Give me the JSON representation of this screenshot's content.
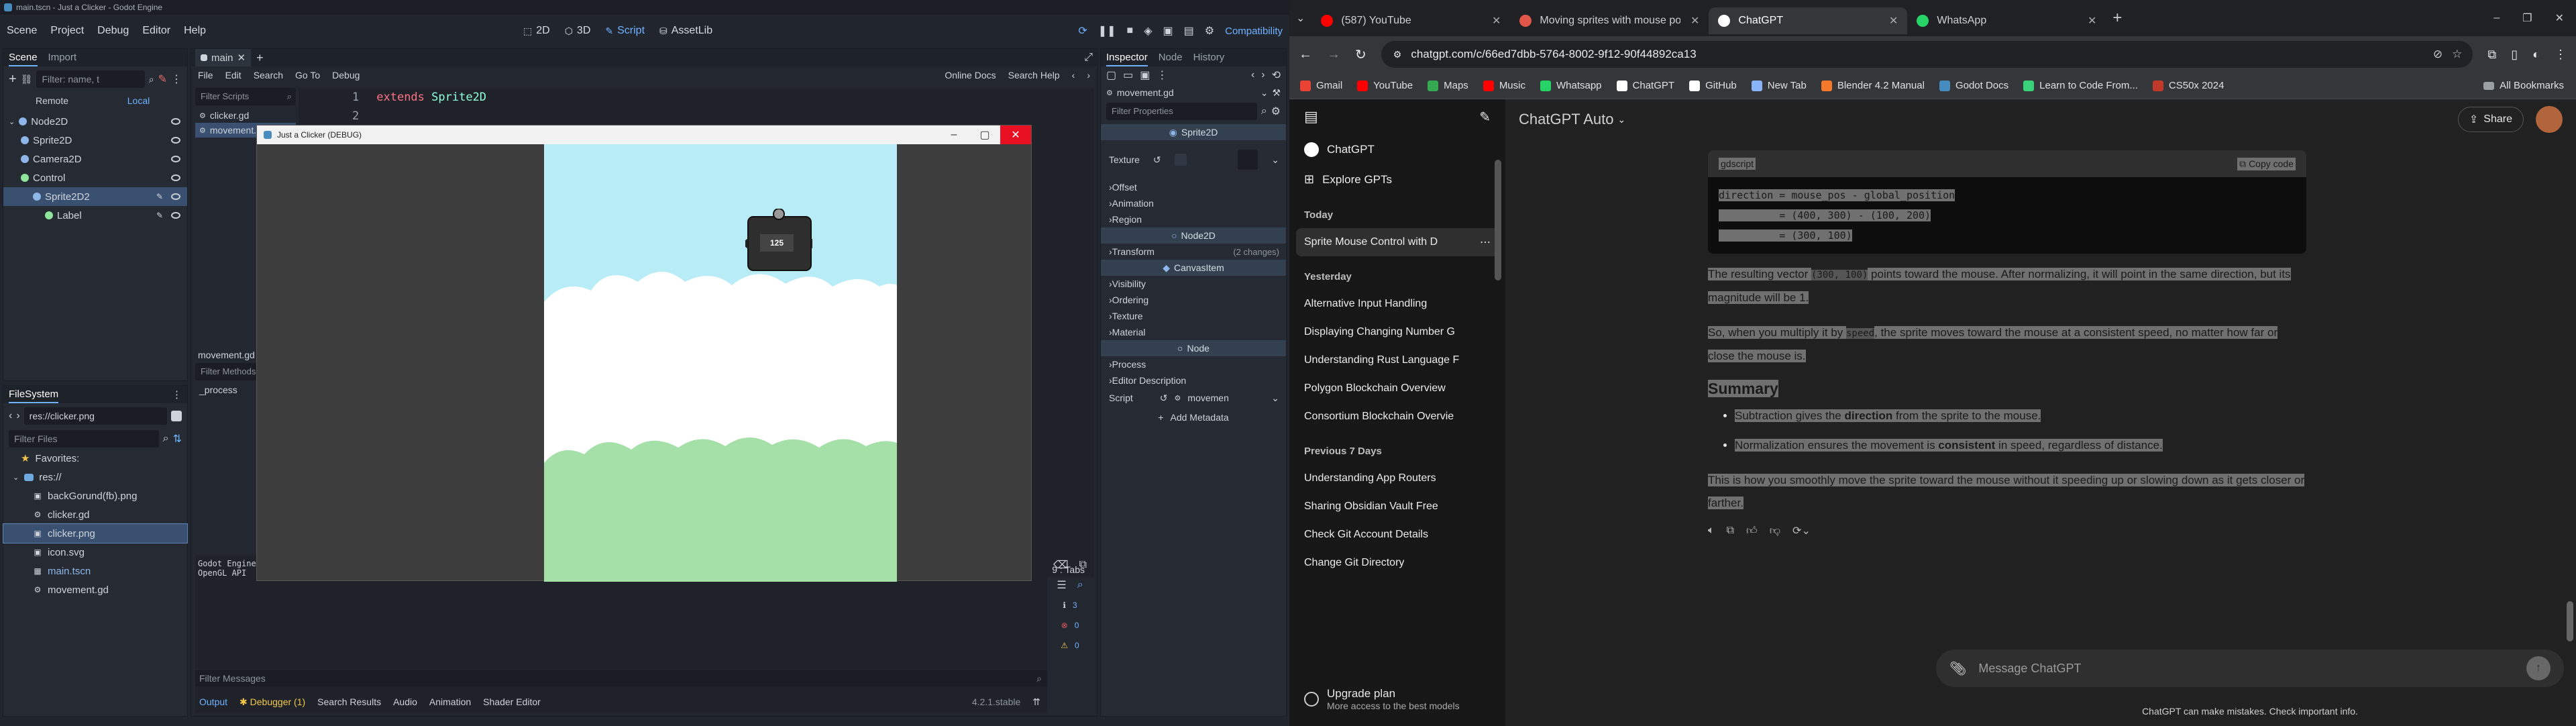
{
  "godot": {
    "window_title": "main.tscn - Just a Clicker - Godot Engine",
    "menu": [
      "Scene",
      "Project",
      "Debug",
      "Editor",
      "Help"
    ],
    "workspaces": [
      "2D",
      "3D",
      "Script",
      "AssetLib"
    ],
    "active_workspace": "Script",
    "renderer": "Compatibility",
    "scene_dock": {
      "tabs": [
        "Scene",
        "Import"
      ],
      "filter_placeholder": "Filter: name, t",
      "remote_local": [
        "Remote",
        "Local"
      ],
      "nodes": [
        {
          "name": "Node2D",
          "indent": 0,
          "icon": "node2d-icon"
        },
        {
          "name": "Sprite2D",
          "indent": 1,
          "icon": "sprite-icon"
        },
        {
          "name": "Camera2D",
          "indent": 1,
          "icon": "camera-icon"
        },
        {
          "name": "Control",
          "indent": 1,
          "icon": "control-icon"
        },
        {
          "name": "Sprite2D2",
          "indent": 2,
          "icon": "sprite-icon",
          "selected": true
        },
        {
          "name": "Label",
          "indent": 3,
          "icon": "label-icon"
        }
      ]
    },
    "filesystem": {
      "title": "FileSystem",
      "path": "res://clicker.png",
      "filter_placeholder": "Filter Files",
      "favorites": "Favorites:",
      "root": "res://",
      "files": [
        {
          "name": "backGorund(fb).png",
          "icon": "image-icon"
        },
        {
          "name": "clicker.gd",
          "icon": "gear-icon"
        },
        {
          "name": "clicker.png",
          "icon": "image-icon",
          "selected": true
        },
        {
          "name": "icon.svg",
          "icon": "image-icon"
        },
        {
          "name": "main.tscn",
          "icon": "scene-icon"
        },
        {
          "name": "movement.gd",
          "icon": "gear-icon"
        }
      ]
    },
    "script_editor": {
      "menu": [
        "File",
        "Edit",
        "Search",
        "Go To",
        "Debug"
      ],
      "right_links": [
        "Online Docs",
        "Search Help"
      ],
      "tab": "main",
      "filter_scripts": "Filter Scripts",
      "scripts": [
        "clicker.gd",
        "movement.gd"
      ],
      "code_line1_keyword": "extends",
      "code_line1_type": "Sprite2D",
      "line_numbers": [
        "1",
        "2"
      ],
      "methods_label": "movement.gd",
      "filter_methods": "Filter Methods",
      "method": "_process",
      "status": "9 : Tabs"
    },
    "output": {
      "lines": [
        "Godot Engine",
        "OpenGL API"
      ],
      "filter_messages": "Filter Messages",
      "bottom_tabs": [
        "Output",
        "Debugger (1)",
        "Search Results",
        "Audio",
        "Animation",
        "Shader Editor"
      ],
      "version": "4.2.1.stable",
      "counts": [
        "3",
        "0",
        "0"
      ]
    },
    "inspector": {
      "tabs": [
        "Inspector",
        "Node",
        "History"
      ],
      "resource": "movement.gd",
      "filter": "Filter Properties",
      "class_sprite": "Sprite2D",
      "texture_label": "Texture",
      "sections_sprite": [
        "Offset",
        "Animation",
        "Region"
      ],
      "class_node2d": "Node2D",
      "transform": "Transform",
      "transform_changes": "(2 changes)",
      "class_canvas": "CanvasItem",
      "sections_canvas": [
        "Visibility",
        "Ordering",
        "Texture",
        "Material"
      ],
      "class_node": "Node",
      "sections_node": [
        "Process",
        "Editor Description"
      ],
      "script_label": "Script",
      "script_value": "movemen",
      "add_metadata": "Add Metadata"
    },
    "game_window": {
      "title": "Just a Clicker (DEBUG)",
      "counter": "125"
    }
  },
  "chrome": {
    "tabs": [
      {
        "title": "(587) YouTube",
        "icon": "youtube-icon",
        "color": "#ff0000"
      },
      {
        "title": "Moving sprites with mouse po",
        "icon": "godot-icon",
        "color": "#e0574a"
      },
      {
        "title": "ChatGPT",
        "icon": "chatgpt-icon",
        "color": "#ffffff",
        "active": true
      },
      {
        "title": "WhatsApp",
        "icon": "whatsapp-icon",
        "color": "#25d366"
      }
    ],
    "url": "chatgpt.com/c/66ed7dbb-5764-8002-9f12-90f44892ca13",
    "bookmarks": [
      {
        "label": "Gmail",
        "color": "#ea4335"
      },
      {
        "label": "YouTube",
        "color": "#ff0000"
      },
      {
        "label": "Maps",
        "color": "#34a853"
      },
      {
        "label": "Music",
        "color": "#ff0000"
      },
      {
        "label": "Whatsapp",
        "color": "#25d366"
      },
      {
        "label": "ChatGPT",
        "color": "#ffffff"
      },
      {
        "label": "GitHub",
        "color": "#ffffff"
      },
      {
        "label": "New Tab",
        "color": "#8ab4f8"
      },
      {
        "label": "Blender 4.2 Manual",
        "color": "#f5792a"
      },
      {
        "label": "Godot Docs",
        "color": "#478cbf"
      },
      {
        "label": "Learn to Code From...",
        "color": "#3ad17b"
      },
      {
        "label": "CS50x 2024",
        "color": "#c0392b"
      }
    ],
    "all_bookmarks": "All Bookmarks",
    "chatgpt": {
      "model": "ChatGPT Auto",
      "share": "Share",
      "nav": [
        "ChatGPT",
        "Explore GPTs"
      ],
      "sections": [
        {
          "heading": "Today",
          "items": [
            "Sprite Mouse Control with D"
          ]
        },
        {
          "heading": "Yesterday",
          "items": [
            "Alternative Input Handling",
            "Displaying Changing Number G",
            "Understanding Rust Language F",
            "Polygon Blockchain Overview",
            "Consortium Blockchain Overvie"
          ]
        },
        {
          "heading": "Previous 7 Days",
          "items": [
            "Understanding App Routers",
            "Sharing Obsidian Vault Free",
            "Check Git Account Details",
            "Change Git Directory"
          ]
        }
      ],
      "upgrade_title": "Upgrade plan",
      "upgrade_sub": "More access to the best models",
      "code_lang": "gdscript",
      "copy_code": "Copy code",
      "code_lines": [
        "direction = mouse_pos - global_position",
        "          = (400, 300) - (100, 200)",
        "          = (300, 100)"
      ],
      "p1_a": "The resulting vector ",
      "p1_code": "(300, 100)",
      "p1_b": " points toward the mouse. After normalizing, it will point in the same direction, but its magnitude will be 1.",
      "p2_a": "So, when you multiply it by ",
      "p2_code": "speed",
      "p2_b": ", the sprite moves toward the mouse at a consistent speed, no matter how far or close the mouse is.",
      "summary_heading": "Summary",
      "bullet1_a": "Subtraction gives the ",
      "bullet1_b": "direction",
      "bullet1_c": " from the sprite to the mouse.",
      "bullet2_a": "Normalization ensures the movement is ",
      "bullet2_b": "consistent",
      "bullet2_c": " in speed, regardless of distance.",
      "closing": "This is how you smoothly move the sprite toward the mouse without it speeding up or slowing down as it gets closer or farther.",
      "input_placeholder": "Message ChatGPT",
      "disclaimer": "ChatGPT can make mistakes. Check important info."
    }
  }
}
